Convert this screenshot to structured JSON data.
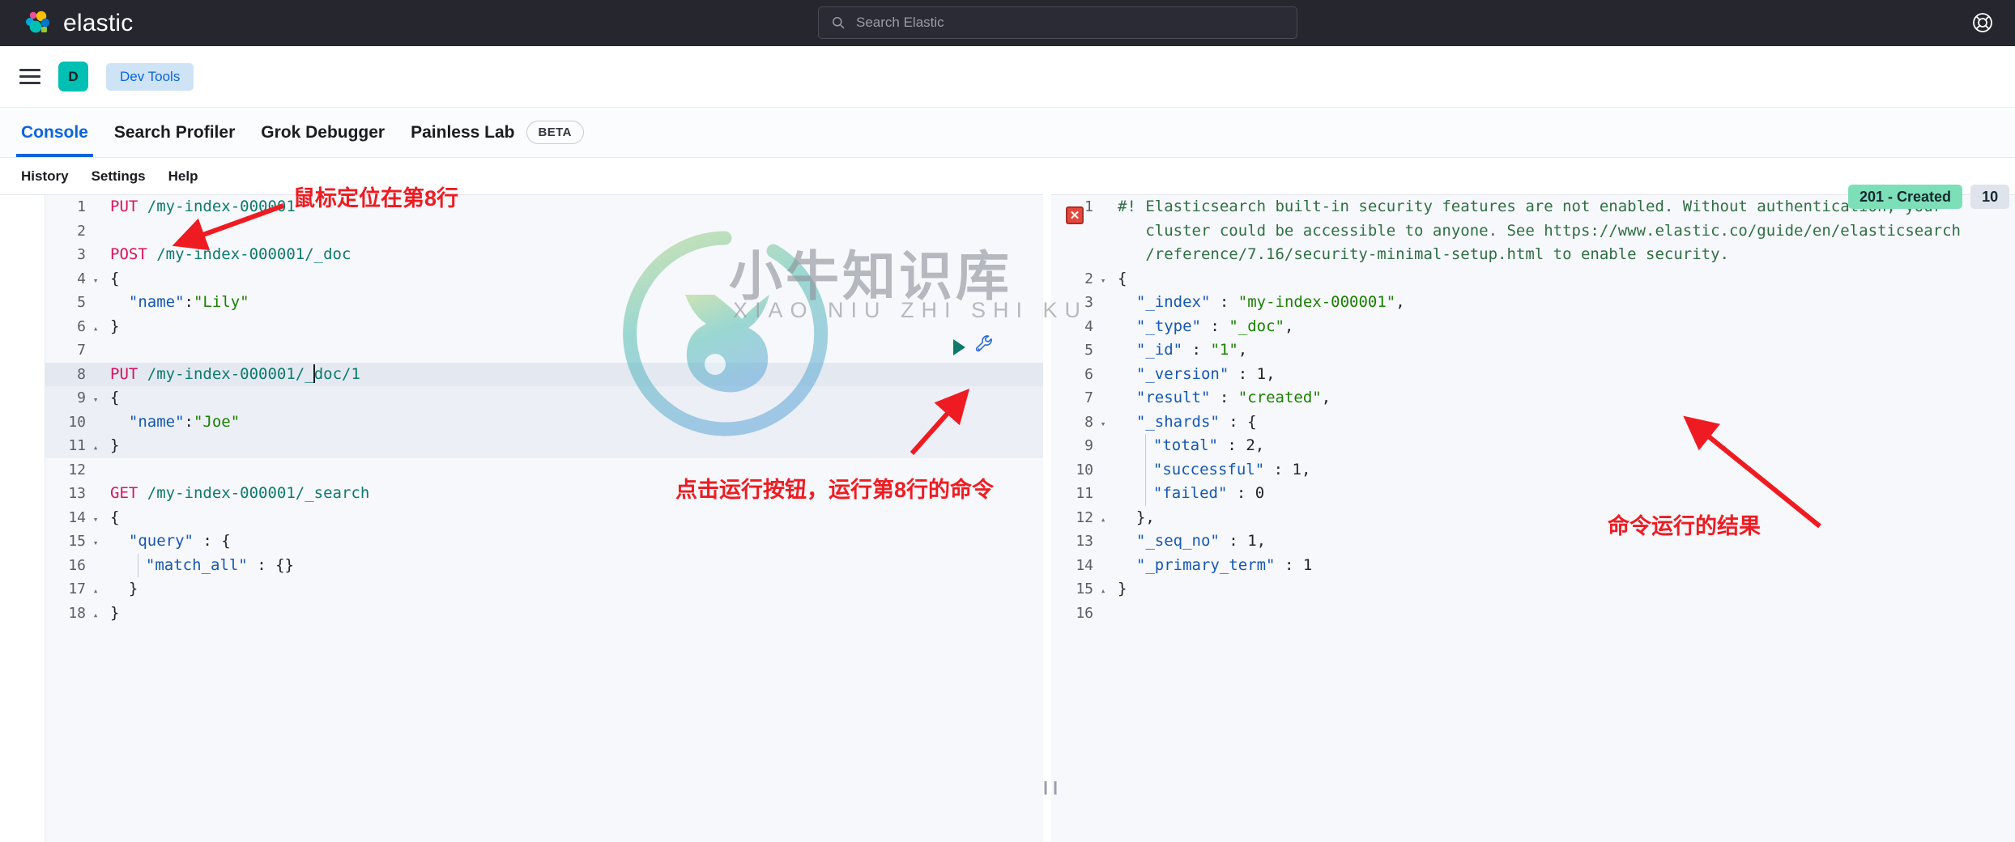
{
  "topbar": {
    "brand": "elastic",
    "brand_logo_icon": "elastic-logo-icon",
    "search": {
      "icon": "search-icon",
      "placeholder": "Search Elastic",
      "value": ""
    },
    "help_icon": "lifebuoy-help-icon"
  },
  "navbar": {
    "menu_icon": "hamburger-menu-icon",
    "space_initial": "D",
    "breadcrumb": "Dev Tools"
  },
  "tabs": [
    {
      "label": "Console",
      "active": true,
      "badge": ""
    },
    {
      "label": "Search Profiler",
      "active": false,
      "badge": ""
    },
    {
      "label": "Grok Debugger",
      "active": false,
      "badge": ""
    },
    {
      "label": "Painless Lab",
      "active": false,
      "badge": "BETA"
    }
  ],
  "console_menu": [
    {
      "label": "History"
    },
    {
      "label": "Settings"
    },
    {
      "label": "Help"
    }
  ],
  "editor": {
    "name": "request-editor",
    "cursor_line": 8,
    "highlighted_lines": [
      8,
      9,
      10,
      11
    ],
    "lines": [
      {
        "n": "1",
        "fold": "",
        "text": "PUT /my-index-000001"
      },
      {
        "n": "2",
        "fold": "",
        "text": ""
      },
      {
        "n": "3",
        "fold": "",
        "text": "POST /my-index-000001/_doc"
      },
      {
        "n": "4",
        "fold": "▾",
        "text": "{"
      },
      {
        "n": "5",
        "fold": "",
        "text": "  \"name\":\"Lily\""
      },
      {
        "n": "6",
        "fold": "▴",
        "text": "}"
      },
      {
        "n": "7",
        "fold": "",
        "text": ""
      },
      {
        "n": "8",
        "fold": "",
        "text": "PUT /my-index-000001/_doc/1"
      },
      {
        "n": "9",
        "fold": "▾",
        "text": "{"
      },
      {
        "n": "10",
        "fold": "",
        "text": "  \"name\":\"Joe\""
      },
      {
        "n": "11",
        "fold": "▴",
        "text": "}"
      },
      {
        "n": "12",
        "fold": "",
        "text": ""
      },
      {
        "n": "13",
        "fold": "",
        "text": "GET /my-index-000001/_search"
      },
      {
        "n": "14",
        "fold": "▾",
        "text": "{"
      },
      {
        "n": "15",
        "fold": "▾",
        "text": "  \"query\" : {"
      },
      {
        "n": "16",
        "fold": "",
        "text": "    \"match_all\" : {}"
      },
      {
        "n": "17",
        "fold": "▴",
        "text": "  }"
      },
      {
        "n": "18",
        "fold": "▴",
        "text": "}"
      }
    ],
    "run_play_icon": "run-request-play-icon",
    "wrench_icon": "wrench-actions-icon"
  },
  "response": {
    "name": "response-output",
    "status_badge": "201 - Created",
    "time_badge": "10",
    "error_marker": "✕",
    "warning_line": {
      "n": "1",
      "part1": "#! Elasticsearch built-in security features are not enabled. Without authentication, your",
      "part2": "cluster could be accessible to anyone. See https://www.elastic.co/guide/en/elasticsearch",
      "part3": "/reference/7.16/security-minimal-setup.html to enable security."
    },
    "lines": [
      {
        "n": "2",
        "fold": "▾",
        "text": "{"
      },
      {
        "n": "3",
        "fold": "",
        "text": "  \"_index\" : \"my-index-000001\","
      },
      {
        "n": "4",
        "fold": "",
        "text": "  \"_type\" : \"_doc\","
      },
      {
        "n": "5",
        "fold": "",
        "text": "  \"_id\" : \"1\","
      },
      {
        "n": "6",
        "fold": "",
        "text": "  \"_version\" : 1,"
      },
      {
        "n": "7",
        "fold": "",
        "text": "  \"result\" : \"created\","
      },
      {
        "n": "8",
        "fold": "▾",
        "text": "  \"_shards\" : {"
      },
      {
        "n": "9",
        "fold": "",
        "text": "    \"total\" : 2,"
      },
      {
        "n": "10",
        "fold": "",
        "text": "    \"successful\" : 1,"
      },
      {
        "n": "11",
        "fold": "",
        "text": "    \"failed\" : 0"
      },
      {
        "n": "12",
        "fold": "▴",
        "text": "  },"
      },
      {
        "n": "13",
        "fold": "",
        "text": "  \"_seq_no\" : 1,"
      },
      {
        "n": "14",
        "fold": "",
        "text": "  \"_primary_term\" : 1"
      },
      {
        "n": "15",
        "fold": "▴",
        "text": "}"
      },
      {
        "n": "16",
        "fold": "",
        "text": ""
      }
    ]
  },
  "pane_handle": "❙❙",
  "annotations": [
    {
      "id": "anno-cursor-line",
      "text": "鼠标定位在第8行"
    },
    {
      "id": "anno-run-button",
      "text": "点击运行按钮，运行第8行的命令"
    },
    {
      "id": "anno-result",
      "text": "命令运行的结果"
    }
  ],
  "watermark": {
    "logo": "bull-circle-watermark",
    "title": "小牛知识库",
    "subtitle": "XIAO NIU ZHI SHI KU"
  },
  "colors": {
    "brand_dark": "#25262e",
    "accent_blue": "#0b64dd",
    "teal": "#00bfb3",
    "success_badge": "#7ddfb8",
    "annotation_red": "#ee1c22",
    "method": "#d6145c",
    "url": "#0c7a6d",
    "string": "#1a8000",
    "key": "#1558b0"
  }
}
